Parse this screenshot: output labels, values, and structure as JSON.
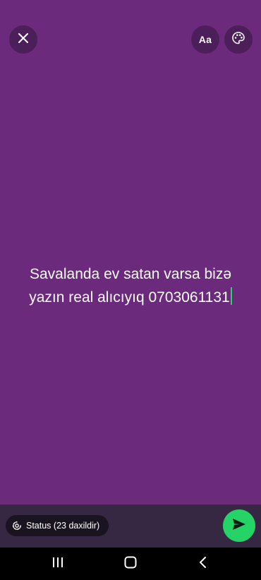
{
  "header": {
    "font_button_label": "Aa"
  },
  "status": {
    "text": "Savalanda ev satan varsa bizə\nyazın real alıcıyıq 0703061131",
    "background_color": "#6b2a7b",
    "caret_color": "#25d366"
  },
  "footer": {
    "audience_label": "Status (23 daxildir)",
    "send_icon": "send-icon",
    "accent_color": "#25d366"
  },
  "system_nav": {
    "icons": [
      "recents-icon",
      "home-icon",
      "back-icon"
    ]
  }
}
